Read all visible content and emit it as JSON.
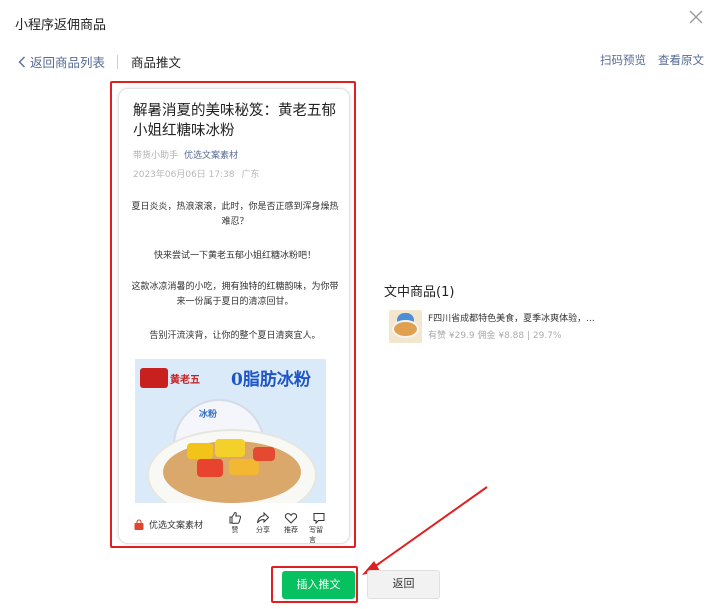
{
  "dialog": {
    "title": "小程序返佣商品",
    "close_icon": "close-icon"
  },
  "nav": {
    "back_label": "返回商品列表",
    "current": "商品推文",
    "actions": [
      "扫码预览",
      "查看原文"
    ]
  },
  "article": {
    "title": "解暑消夏的美味秘笈：黄老五郁小姐红糖味冰粉",
    "author": "带货小助手",
    "source_tag": "优选文案素材",
    "date": "2023年06月06日 17:38",
    "location": "广东",
    "paragraphs": [
      "夏日炎炎，热浪滚滚，此时，你是否正感到浑身燥热难忍？",
      "快来尝试一下黄老五郁小姐红糖冰粉吧！",
      "这款冰凉消暑的小吃，拥有独特的红糖韵味，为你带来一份属于夏日的清凉回甘。",
      "告别汗流浃背，让你的整个夏日清爽宜人。"
    ],
    "banner": {
      "brand": "黄老五",
      "headline": "0脂肪冰粉",
      "product_label": "冰粉"
    },
    "footer": {
      "source": "优选文案素材",
      "actions": [
        {
          "label": "赞",
          "icon": "thumbs-up-icon"
        },
        {
          "label": "分享",
          "icon": "share-icon"
        },
        {
          "label": "推荐",
          "icon": "heart-icon"
        },
        {
          "label": "写留言",
          "icon": "comment-icon"
        }
      ]
    }
  },
  "goods": {
    "header": "文中商品(1)",
    "items": [
      {
        "name": "F四川省成都特色美食，夏季冰爽体验，...",
        "meta": "有赞 ¥29.9 佣金 ¥8.88 | 29.7%"
      }
    ]
  },
  "buttons": {
    "insert": "插入推文",
    "back": "返回"
  },
  "colors": {
    "accent_green": "#07c160",
    "link_blue": "#576b95",
    "highlight_red": "#e02020"
  }
}
